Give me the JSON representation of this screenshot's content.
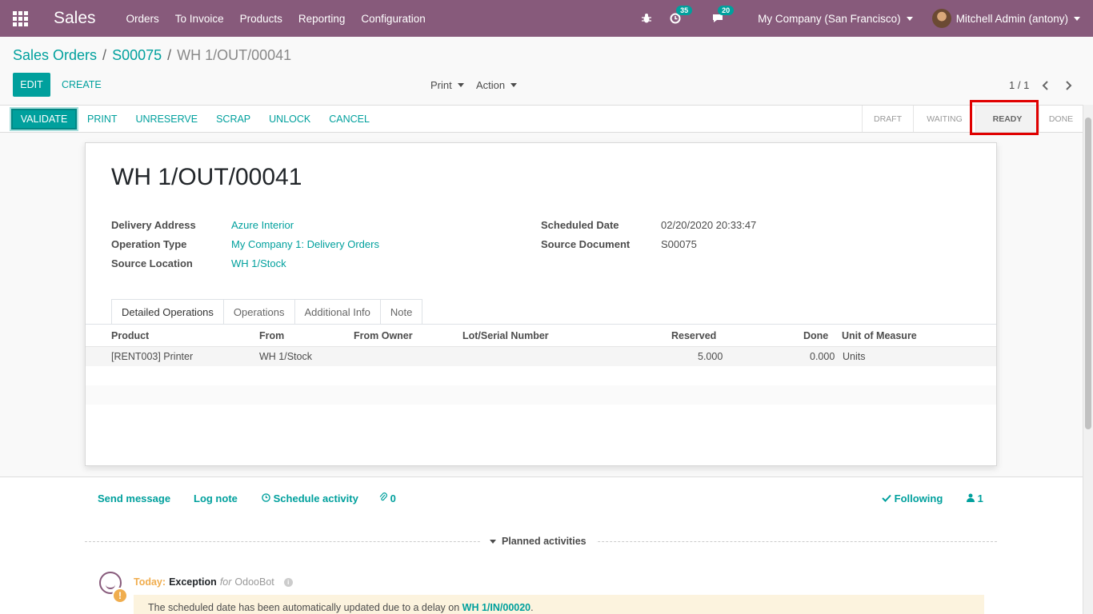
{
  "navbar": {
    "app_name": "Sales",
    "menu": [
      "Orders",
      "To Invoice",
      "Products",
      "Reporting",
      "Configuration"
    ],
    "activity_count": "35",
    "message_count": "20",
    "company": "My Company (San Francisco)",
    "user": "Mitchell Admin (antony)"
  },
  "breadcrumb": {
    "root": "Sales Orders",
    "sep": "/",
    "order": "S00075",
    "current": "WH 1/OUT/00041"
  },
  "control": {
    "edit": "EDIT",
    "create": "CREATE",
    "print": "Print",
    "action": "Action",
    "pager": "1 / 1"
  },
  "statusbar": {
    "buttons": [
      "VALIDATE",
      "PRINT",
      "UNRESERVE",
      "SCRAP",
      "UNLOCK",
      "CANCEL"
    ],
    "stages": [
      "DRAFT",
      "WAITING",
      "READY",
      "DONE"
    ],
    "active_stage": "READY"
  },
  "record": {
    "name": "WH 1/OUT/00041",
    "delivery_address_label": "Delivery Address",
    "delivery_address": "Azure Interior",
    "operation_type_label": "Operation Type",
    "operation_type": "My Company 1: Delivery Orders",
    "source_location_label": "Source Location",
    "source_location": "WH 1/Stock",
    "scheduled_date_label": "Scheduled Date",
    "scheduled_date": "02/20/2020 20:33:47",
    "source_document_label": "Source Document",
    "source_document": "S00075"
  },
  "tabs": [
    "Detailed Operations",
    "Operations",
    "Additional Info",
    "Note"
  ],
  "table": {
    "headers": [
      "Product",
      "From",
      "From Owner",
      "Lot/Serial Number",
      "Reserved",
      "Done",
      "Unit of Measure"
    ],
    "rows": [
      {
        "product": "[RENT003] Printer",
        "from": "WH 1/Stock",
        "owner": "",
        "lot": "",
        "reserved": "5.000",
        "done": "0.000",
        "uom": "Units"
      }
    ]
  },
  "chatter": {
    "send_message": "Send message",
    "log_note": "Log note",
    "schedule_activity": "Schedule activity",
    "attachments": "0",
    "following": "Following",
    "followers": "1",
    "planned_activities": "Planned activities",
    "activity": {
      "when": "Today",
      "colon": ":",
      "type": "Exception",
      "for": "for",
      "user": "OdooBot",
      "note_prefix": "The scheduled date has been automatically updated due to a delay on",
      "note_ref": "WH 1/IN/00020",
      "note_suffix": "."
    }
  },
  "colors": {
    "brand": "#875a7b",
    "accent": "#00a09d",
    "highlight": "#e00000"
  }
}
